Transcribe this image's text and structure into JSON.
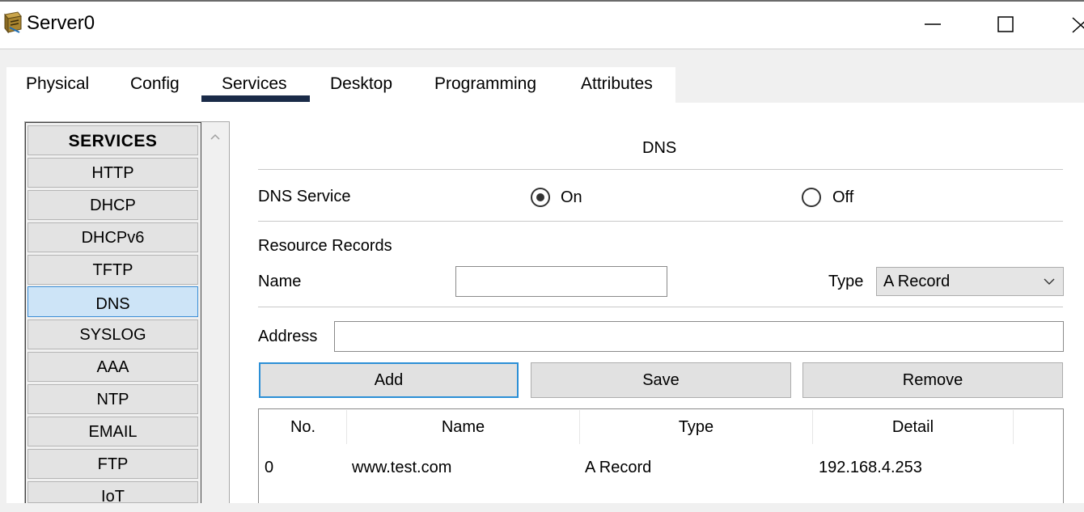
{
  "window": {
    "title": "Server0",
    "minimize_icon": "minimize-icon",
    "maximize_icon": "maximize-icon",
    "close_icon": "close-icon"
  },
  "tabs": [
    {
      "label": "Physical"
    },
    {
      "label": "Config"
    },
    {
      "label": "Services",
      "active": true
    },
    {
      "label": "Desktop"
    },
    {
      "label": "Programming"
    },
    {
      "label": "Attributes"
    }
  ],
  "services": {
    "header": "SERVICES",
    "items": [
      {
        "label": "HTTP"
      },
      {
        "label": "DHCP"
      },
      {
        "label": "DHCPv6"
      },
      {
        "label": "TFTP"
      },
      {
        "label": "DNS",
        "selected": true
      },
      {
        "label": "SYSLOG"
      },
      {
        "label": "AAA"
      },
      {
        "label": "NTP"
      },
      {
        "label": "EMAIL"
      },
      {
        "label": "FTP"
      },
      {
        "label": "IoT"
      }
    ]
  },
  "dns": {
    "title": "DNS",
    "service_label": "DNS Service",
    "on_label": "On",
    "off_label": "Off",
    "service_state": "On",
    "resource_records_label": "Resource Records",
    "name_label": "Name",
    "name_value": "",
    "type_label": "Type",
    "type_value": "A Record",
    "address_label": "Address",
    "address_value": "",
    "add_label": "Add",
    "save_label": "Save",
    "remove_label": "Remove"
  },
  "table": {
    "columns": [
      "No.",
      "Name",
      "Type",
      "Detail"
    ],
    "rows": [
      [
        "0",
        "www.test.com",
        "A Record",
        "192.168.4.253"
      ]
    ]
  },
  "colors": {
    "tab_underline": "#1a2b48",
    "selected_service_bg": "#cde4f7",
    "focus_border": "#2b8fd6"
  }
}
